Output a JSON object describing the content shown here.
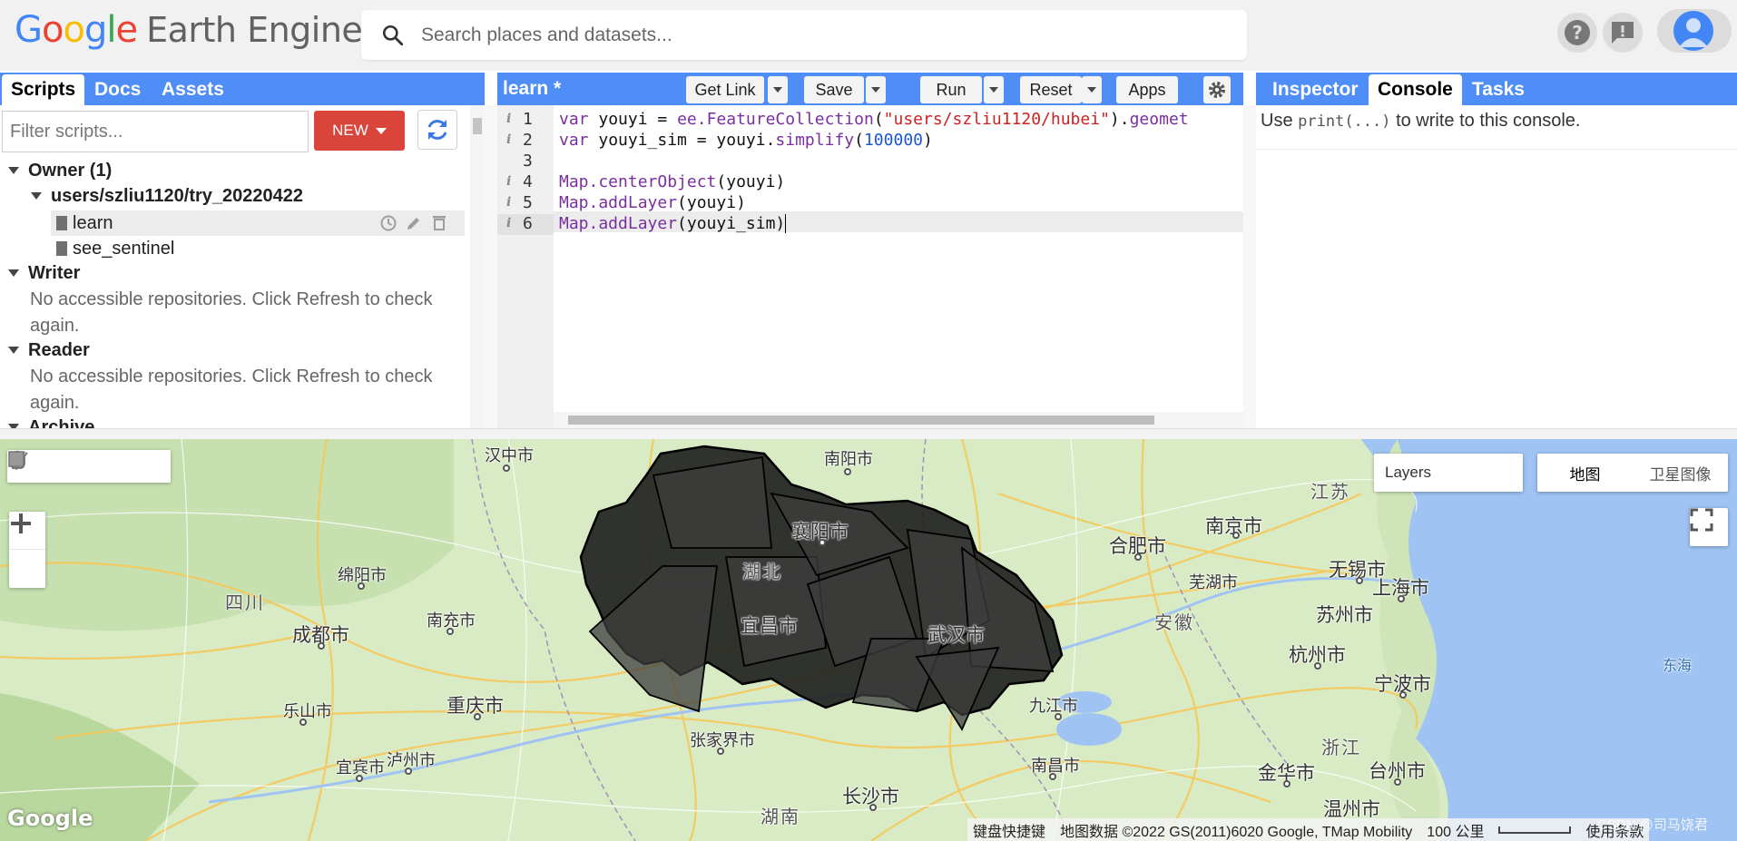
{
  "header": {
    "logo_google": "Google",
    "logo_product": "Earth Engine",
    "search_placeholder": "Search places and datasets..."
  },
  "left_tabs": [
    "Scripts",
    "Docs",
    "Assets"
  ],
  "scripts": {
    "filter_placeholder": "Filter scripts...",
    "new_label": "NEW",
    "owner_label": "Owner (1)",
    "repo": "users/szliu1120/try_20220422",
    "files": [
      "learn",
      "see_sentinel"
    ],
    "writer_label": "Writer",
    "writer_note": "No accessible repositories. Click Refresh to check again.",
    "reader_label": "Reader",
    "reader_note": "No accessible repositories. Click Refresh to check again.",
    "archive_label": "Archive"
  },
  "editor": {
    "title": "learn *",
    "buttons": {
      "get_link": "Get Link",
      "save": "Save",
      "run": "Run",
      "reset": "Reset",
      "apps": "Apps"
    },
    "line_numbers": [
      "1",
      "2",
      "3",
      "4",
      "5",
      "6"
    ],
    "code_lines": [
      "var youyi = ee.FeatureCollection(\"users/szliu1120/hubei\").geomet",
      "var youyi_sim = youyi.simplify(100000)",
      "",
      "Map.centerObject(youyi)",
      "Map.addLayer(youyi)",
      "Map.addLayer(youyi_sim)"
    ]
  },
  "right_tabs": [
    "Inspector",
    "Console",
    "Tasks"
  ],
  "console": {
    "prefix": "Use",
    "code": "print(...)",
    "suffix": "to write to this console."
  },
  "map": {
    "layers_label": "Layers",
    "map_type_options": [
      "地图",
      "卫星图像"
    ],
    "selected_map_type": "地图",
    "watermark": "Google",
    "attribution": {
      "shortcuts": "键盘快捷键",
      "data": "地图数据 ©2022 GS(2011)6020 Google, TMap Mobility",
      "scale": "100 公里",
      "terms": "使用条款"
    },
    "csdn_mark": "CSDN @司马饶君",
    "labels": {
      "hanzhong": "汉中市",
      "nanyang": "南阳市",
      "jiangsu": "江苏",
      "nanjing": "南京市",
      "hefei": "合肥市",
      "xiangyang": "襄阳市",
      "hubei": "湖北",
      "mianyang": "绵阳市",
      "wuhu": "芜湖市",
      "wuxi": "无锡市",
      "shanghai": "上海市",
      "sichuan": "四川",
      "nanchong": "南充市",
      "yichang": "宜昌市",
      "wuhan": "武汉市",
      "anhui": "安徽",
      "suzhou": "苏州市",
      "chengdu": "成都市",
      "hangzhou": "杭州市",
      "donghai": "东海",
      "ningbo": "宁波市",
      "leshan": "乐山市",
      "chongqing": "重庆市",
      "jiujiang": "九江市",
      "zhangjiajie": "张家界市",
      "zhejiang": "浙江",
      "luzhou": "泸州市",
      "yibin": "宜宾市",
      "nanchang": "南昌市",
      "jinhua": "金华市",
      "taizhou": "台州市",
      "changsha": "长沙市",
      "wenzhou": "温州市",
      "hunan": "湖南"
    }
  },
  "colors": {
    "tab_blue": "#4f8ef7",
    "new_red": "#d9453b",
    "polygon_fill": "#1e1e1e"
  }
}
